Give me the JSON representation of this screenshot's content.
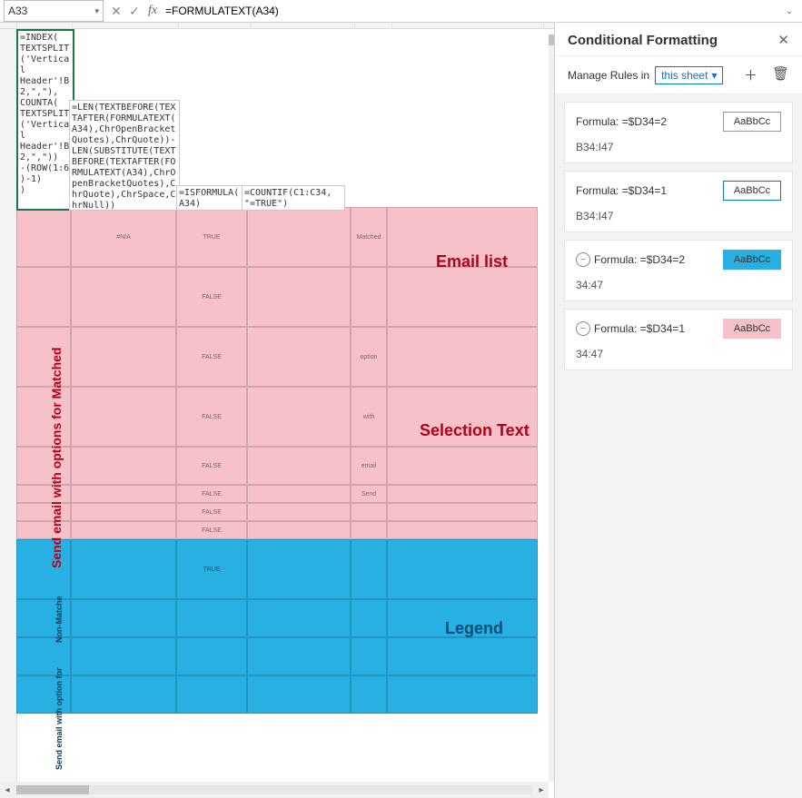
{
  "formula_bar": {
    "cell_ref": "A33",
    "formula": "=FORMULATEXT(A34)"
  },
  "float_cells": {
    "a33": "=INDEX(\nTEXTSPLIT\n('Vertica\nl\nHeader'!B\n2,\",\"),\nCOUNTA(\nTEXTSPLIT\n('Vertica\nl\nHeader'!B\n2,\",\"))\n-(ROW(1:6\n)-1)\n)",
    "b33": "=LEN(TEXTBEFORE(TEX\nTAFTER(FORMULATEXT(\nA34),ChrOpenBracket\nQuotes),ChrQuote))-\nLEN(SUBSTITUTE(TEXT\nBEFORE(TEXTAFTER(FO\nRMULATEXT(A34),ChrO\npenBracketQuotes),C\nhrQuote),ChrSpace,C\nhrNull))",
    "c33": "=ISFORMULA(\nA34)",
    "d33": "=COUNTIF(C1:C34,\n\"=TRUE\")"
  },
  "grid": {
    "vertical_pink": "Send   email  with   options  for    Matched",
    "vertical_blue_top": "Non-Matche",
    "vertical_blue_bottom": "Send  email with  option for",
    "label_email_list": "Email list",
    "label_selection": "Selection Text",
    "label_legend": "Legend",
    "tiny": {
      "na": "#N/A",
      "true": "TRUE",
      "false": "FALSE",
      "matched": "Matched",
      "option": "option",
      "with": "with",
      "email": "email",
      "send": "Send"
    }
  },
  "cf_panel": {
    "title": "Conditional Formatting",
    "manage_label": "Manage Rules in",
    "manage_scope": "this sheet",
    "sample_text": "AaBbCc",
    "rules": [
      {
        "formula": "Formula: =$D34=2",
        "range": "B34:I47",
        "swatch_bg": "#ffffff",
        "swatch_border": "#999",
        "stop": false
      },
      {
        "formula": "Formula: =$D34=1",
        "range": "B34:I47",
        "swatch_bg": "#ffffff",
        "swatch_border": "#0078d4",
        "stop": false
      },
      {
        "formula": "Formula: =$D34=2",
        "range": "34:47",
        "swatch_bg": "#29b0e2",
        "swatch_border": "#29b0e2",
        "stop": true
      },
      {
        "formula": "Formula: =$D34=1",
        "range": "34:47",
        "swatch_bg": "#f7c1c9",
        "swatch_border": "#f7c1c9",
        "stop": true
      }
    ]
  }
}
